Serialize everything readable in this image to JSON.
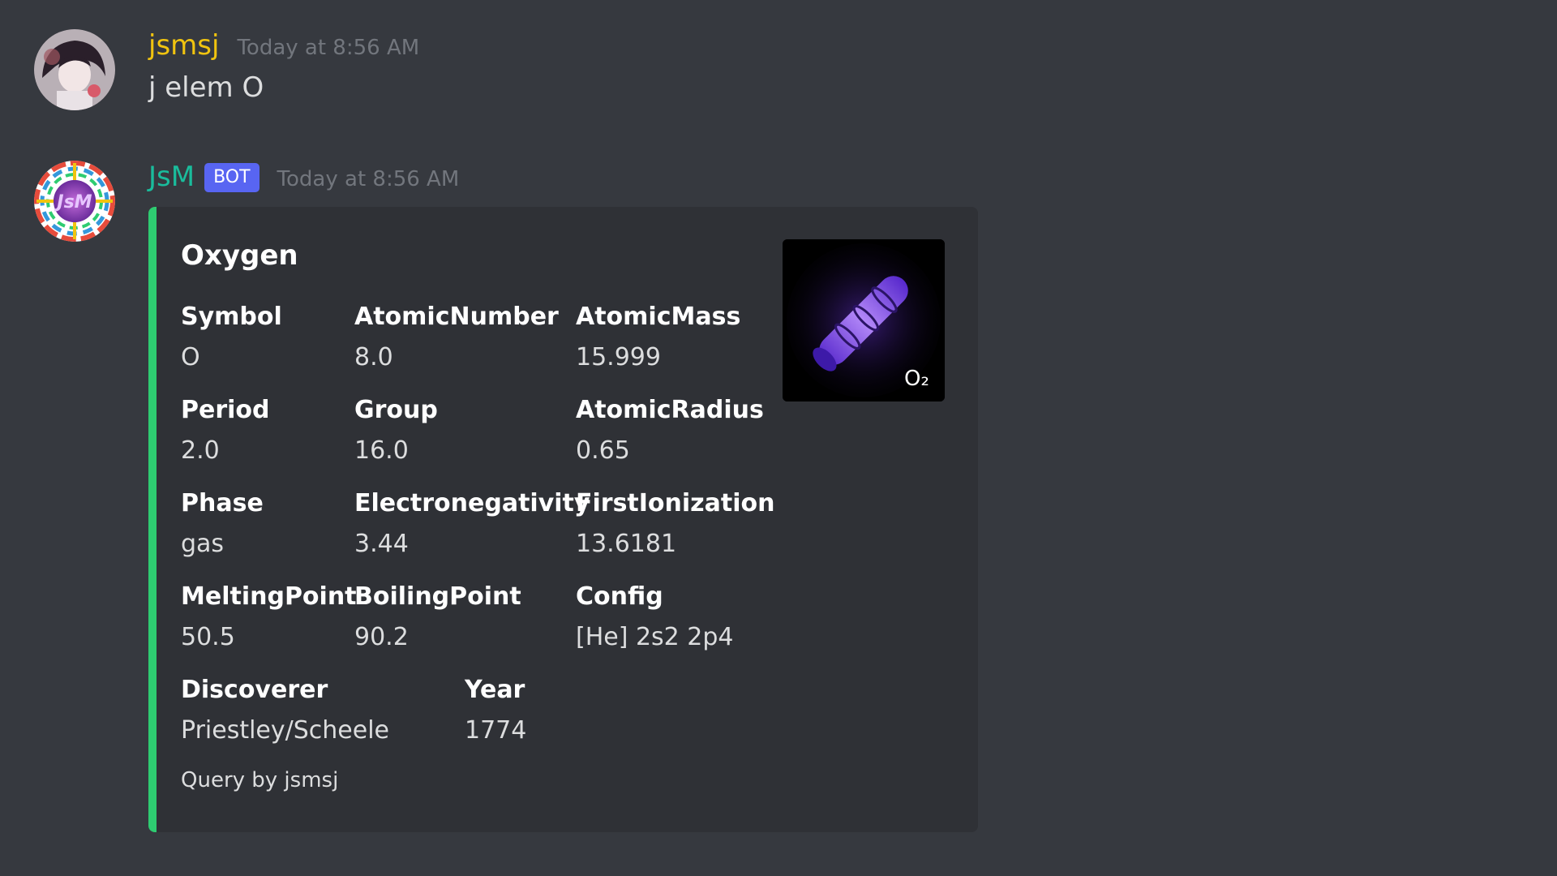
{
  "messages": [
    {
      "username": "jsmsj",
      "username_color": "#f1c40f",
      "timestamp": "Today at 8:56 AM",
      "content": "j elem O"
    },
    {
      "username": "JsM",
      "username_color": "#1abc9c",
      "bot_tag": "BOT",
      "timestamp": "Today at 8:56 AM"
    }
  ],
  "embed": {
    "accent_color": "#2ecc71",
    "title": "Oxygen",
    "thumbnail_label": "O₂",
    "fields": [
      {
        "name": "Symbol",
        "value": "O"
      },
      {
        "name": "AtomicNumber",
        "value": "8.0"
      },
      {
        "name": "AtomicMass",
        "value": "15.999"
      },
      {
        "name": "Period",
        "value": "2.0"
      },
      {
        "name": "Group",
        "value": "16.0"
      },
      {
        "name": "AtomicRadius",
        "value": "0.65"
      },
      {
        "name": "Phase",
        "value": "gas"
      },
      {
        "name": "Electronegativity",
        "value": "3.44"
      },
      {
        "name": "FirstIonization",
        "value": "13.6181"
      },
      {
        "name": "MeltingPoint",
        "value": "50.5"
      },
      {
        "name": "BoilingPoint",
        "value": "90.2"
      },
      {
        "name": "Config",
        "value": "[He] 2s2 2p4"
      },
      {
        "name": "Discoverer",
        "value": "Priestley/Scheele"
      },
      {
        "name": "Year",
        "value": "1774"
      }
    ],
    "footer": "Query by jsmsj"
  }
}
